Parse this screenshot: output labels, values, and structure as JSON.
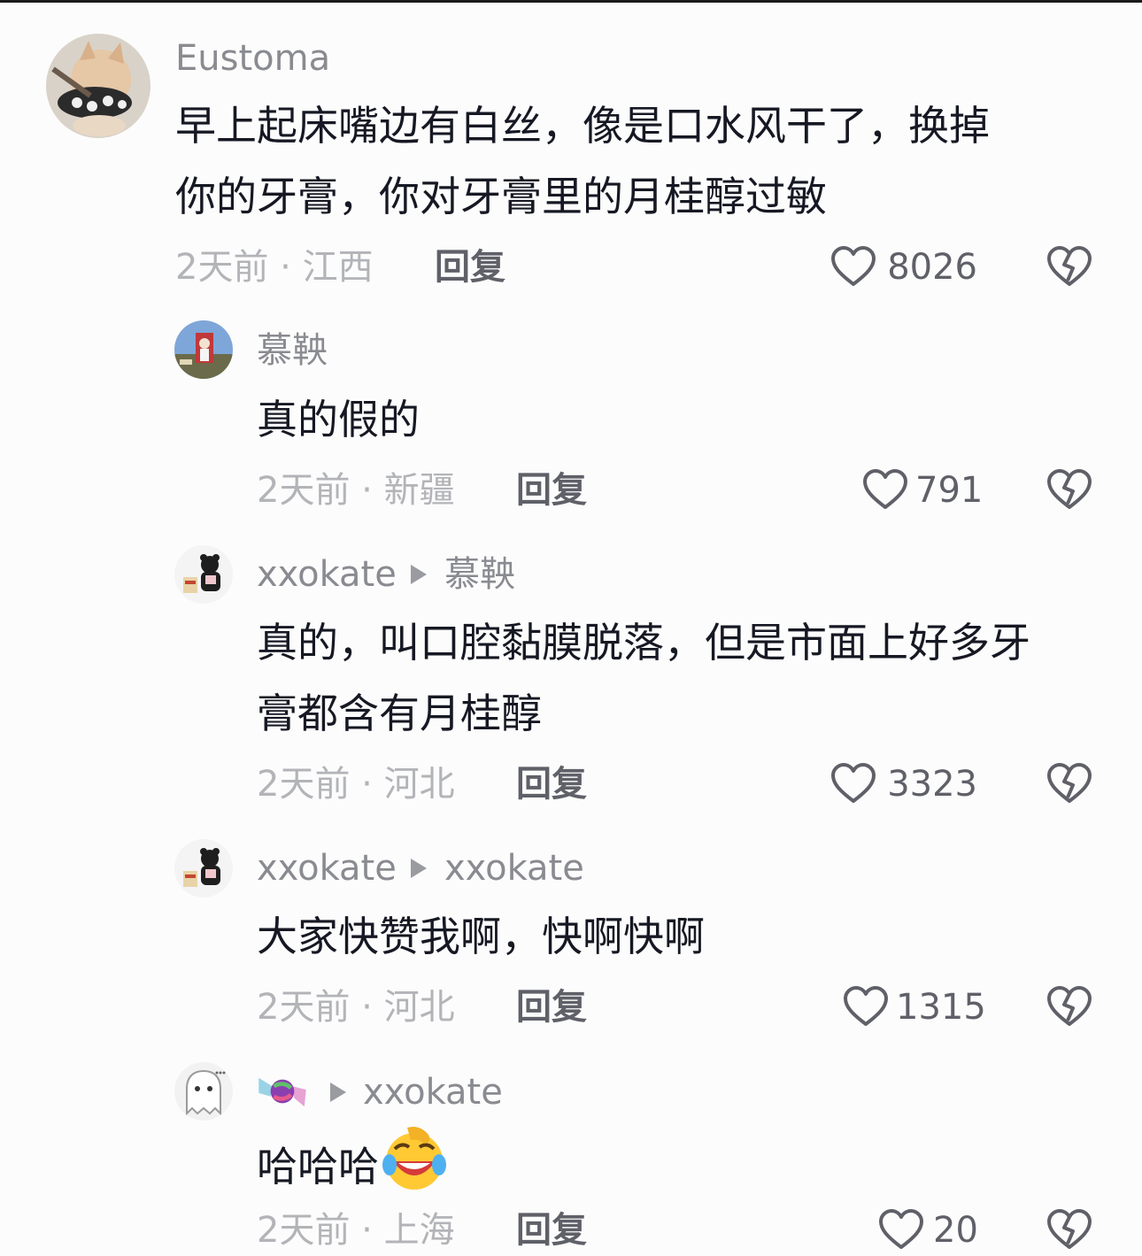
{
  "comments": [
    {
      "username": "Eustoma",
      "reply_to": "",
      "text": "早上起床嘴边有白丝，像是口水风干了，换掉你的牙膏，你对牙膏里的月桂醇过敏",
      "text_lines": [
        "早上起床嘴边有白丝，像是口水风干了，换掉",
        "你的牙膏，你对牙膏里的月桂醇过敏"
      ],
      "time": "2天前",
      "location": "江西",
      "reply_label": "回复",
      "likes": "8026",
      "avatar_icon": "cat-avatar"
    },
    {
      "username": "慕鞅",
      "reply_to": "",
      "text": "真的假的",
      "time": "2天前",
      "location": "新疆",
      "reply_label": "回复",
      "likes": "791",
      "avatar_icon": "photo-avatar"
    },
    {
      "username": "xxokate",
      "reply_to": "慕鞅",
      "text": "真的，叫口腔黏膜脱落，但是市面上好多牙膏都含有月桂醇",
      "text_lines": [
        "真的，叫口腔黏膜脱落，但是市面上好多牙",
        "膏都含有月桂醇"
      ],
      "time": "2天前",
      "location": "河北",
      "reply_label": "回复",
      "likes": "3323",
      "avatar_icon": "bear-avatar"
    },
    {
      "username": "xxokate",
      "reply_to": "xxokate",
      "text": "大家快赞我啊，快啊快啊",
      "time": "2天前",
      "location": "河北",
      "reply_label": "回复",
      "likes": "1315",
      "avatar_icon": "bear-avatar"
    },
    {
      "username": "🍬",
      "reply_to": "xxokate",
      "text": "哈哈哈",
      "emoji": "laughing-emoji",
      "time": "2天前",
      "location": "上海",
      "reply_label": "回复",
      "likes": "20",
      "avatar_icon": "ghost-avatar"
    }
  ],
  "meta_separator": "·",
  "colors": {
    "background": "#fcfcfc",
    "text": "#161823",
    "username": "#8a8b91",
    "meta": "#b3b4b8",
    "action": "#5f6068"
  }
}
